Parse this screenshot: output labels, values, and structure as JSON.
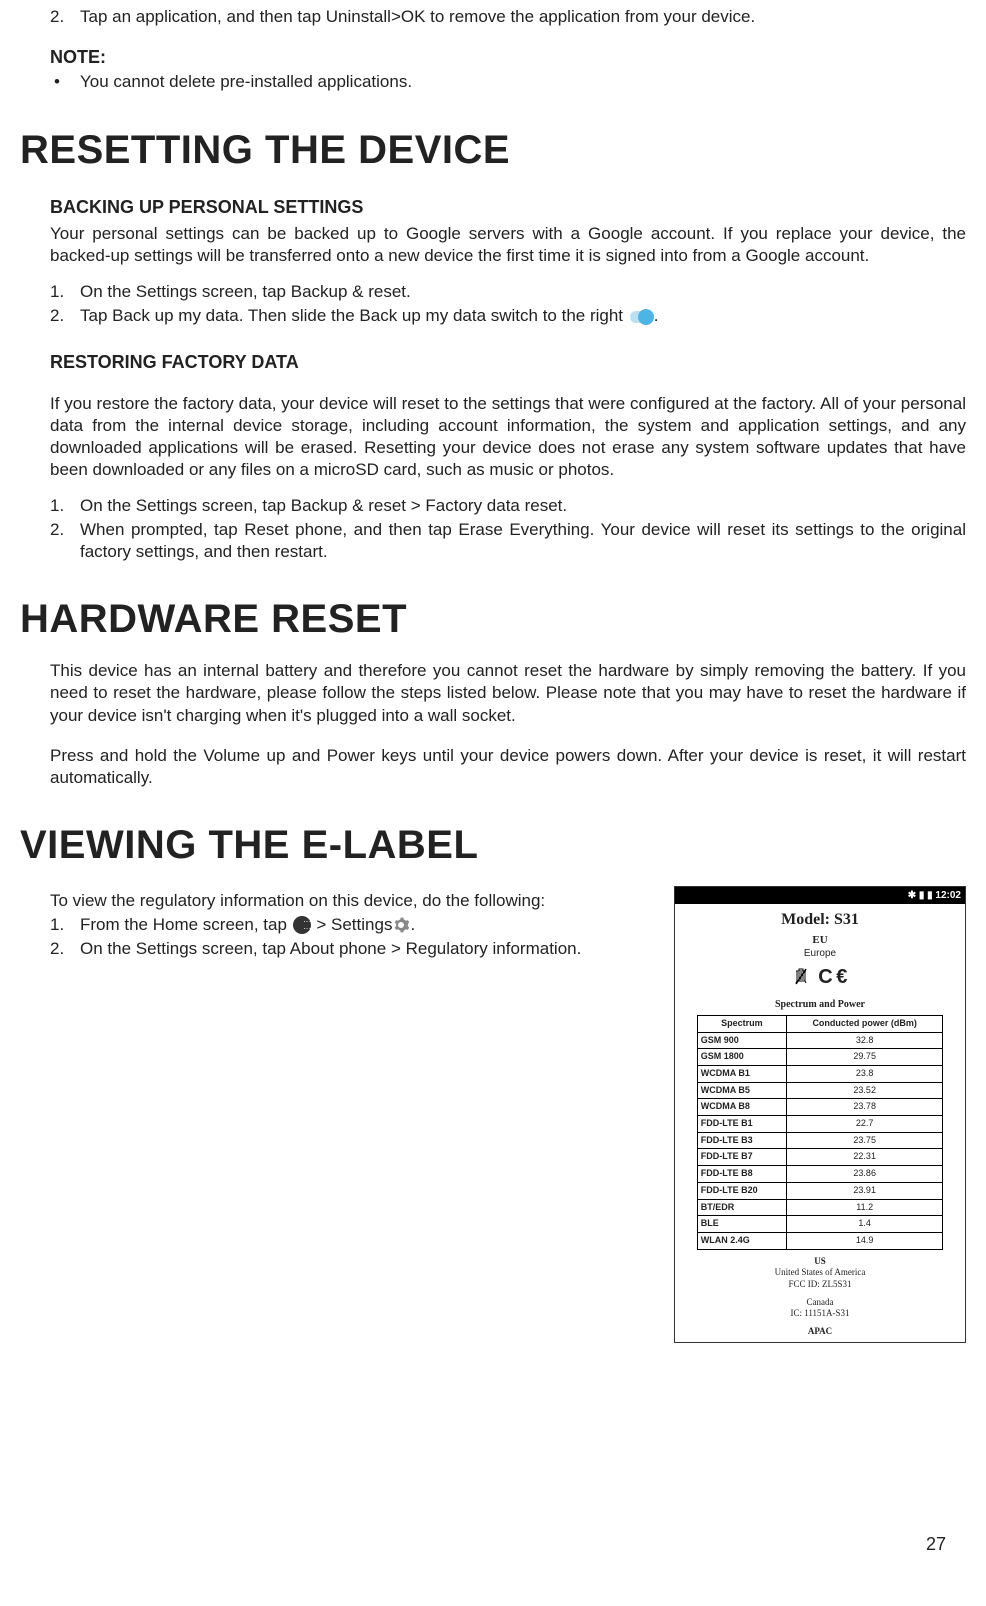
{
  "intro": {
    "step2": "Tap an application, and then tap Uninstall>OK to remove the application from your device.",
    "note_label": "NOTE:",
    "note_bullet": "You cannot delete pre-installed applications."
  },
  "resetting": {
    "heading": "RESETTING THE DEVICE",
    "backup_head": "BACKING UP PERSONAL SETTINGS",
    "backup_para": "Your personal settings can be backed up to Google servers with a Google account. If you replace your device, the backed-up settings will be transferred onto a new device the first time it is signed into from a Google account.",
    "backup_step1": "On the Settings screen, tap Backup & reset.",
    "backup_step2_a": "Tap Back up my data. Then slide the Back up my data switch to the right ",
    "backup_step2_b": ".",
    "restore_head": "RESTORING FACTORY DATA",
    "restore_para": "If you restore the factory data, your device will reset to the settings that were configured at the factory. All of your personal data from the internal device storage, including account information, the system and application settings, and any downloaded applications will be erased. Resetting your device does not erase any system software updates that have been downloaded or any files on a microSD card, such as music or photos.",
    "restore_step1": "On the Settings screen, tap Backup & reset > Factory data reset.",
    "restore_step2": "When prompted, tap Reset phone, and then tap Erase Everything. Your device will reset its settings to the original factory settings, and then restart."
  },
  "hardware": {
    "heading": "HARDWARE RESET",
    "para1": "This device has an internal battery and therefore you cannot reset the hardware by simply removing the battery. If you need to reset the hardware, please follow the steps listed below. Please note that you may have to reset the hardware if your device isn't charging when it's plugged into a wall socket.",
    "para2": "Press and hold the Volume up and Power keys until your device powers down. After your device is reset, it will restart automatically."
  },
  "elabel": {
    "heading": "VIEWING THE E-LABEL",
    "intro": "To view the regulatory information on this device, do the following:",
    "step1_a": "From the Home screen, tap ",
    "step1_b": " > Settings",
    "step1_c": ".",
    "step2": "On the Settings screen, tap About phone > Regulatory information."
  },
  "phone": {
    "status_time": "12:02",
    "status_icons": "✱ ▮ ▮",
    "model": "Model: S31",
    "region": "EU",
    "subregion": "Europe",
    "sp_title": "Spectrum and Power",
    "th1": "Spectrum",
    "th2": "Conducted power (dBm)",
    "rows": [
      {
        "s": "GSM 900",
        "p": "32.8"
      },
      {
        "s": "GSM 1800",
        "p": "29.75"
      },
      {
        "s": "WCDMA B1",
        "p": "23.8"
      },
      {
        "s": "WCDMA B5",
        "p": "23.52"
      },
      {
        "s": "WCDMA B8",
        "p": "23.78"
      },
      {
        "s": "FDD-LTE B1",
        "p": "22.7"
      },
      {
        "s": "FDD-LTE B3",
        "p": "23.75"
      },
      {
        "s": "FDD-LTE  B7",
        "p": "22.31"
      },
      {
        "s": "FDD-LTE  B8",
        "p": "23.86"
      },
      {
        "s": "FDD-LTE B20",
        "p": "23.91"
      },
      {
        "s": "BT/EDR",
        "p": "11.2"
      },
      {
        "s": "BLE",
        "p": "1.4"
      },
      {
        "s": "WLAN 2.4G",
        "p": "14.9"
      }
    ],
    "us": "US",
    "us_country": "United States of America",
    "us_fcc": "FCC ID: ZL5S31",
    "ca": "Canada",
    "ca_ic": "IC: 11151A-S31",
    "apac": "APAC"
  },
  "page_number": "27"
}
